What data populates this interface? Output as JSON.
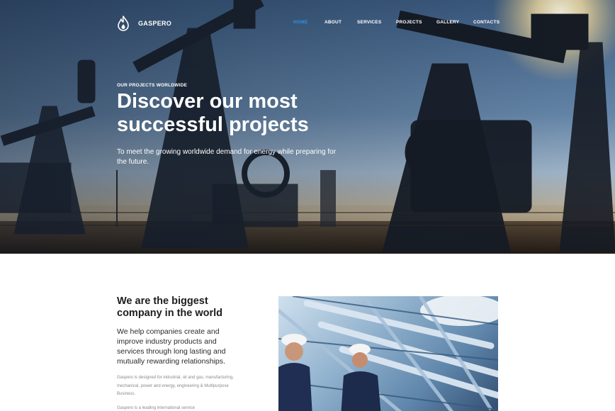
{
  "brand": {
    "name": "GASPERO",
    "logo_icon": "flame-icon"
  },
  "nav": {
    "items": [
      {
        "label": "HOME",
        "active": true
      },
      {
        "label": "ABOUT",
        "active": false
      },
      {
        "label": "SERVICES",
        "active": false
      },
      {
        "label": "PROJECTS",
        "active": false
      },
      {
        "label": "GALLERY",
        "active": false
      },
      {
        "label": "CONTACTS",
        "active": false
      }
    ],
    "active_color": "#2f8fe6"
  },
  "hero": {
    "eyebrow": "OUR PROJECTS WORLDWIDE",
    "title": "Discover our most successful projects",
    "subtitle": "To meet the growing worldwide demand for energy while preparing for the future."
  },
  "about": {
    "title": "We are the biggest company in the world",
    "lead": "We help companies create and improve industry products and services through long lasting and mutually rewarding relationships.",
    "paragraph1": "Gaspero is designed for industrial, oil and gas, manufacturing, mechanical, power and energy, engineering & Multipurpose Business.",
    "paragraph2": "Gaspero is a leading international service"
  }
}
